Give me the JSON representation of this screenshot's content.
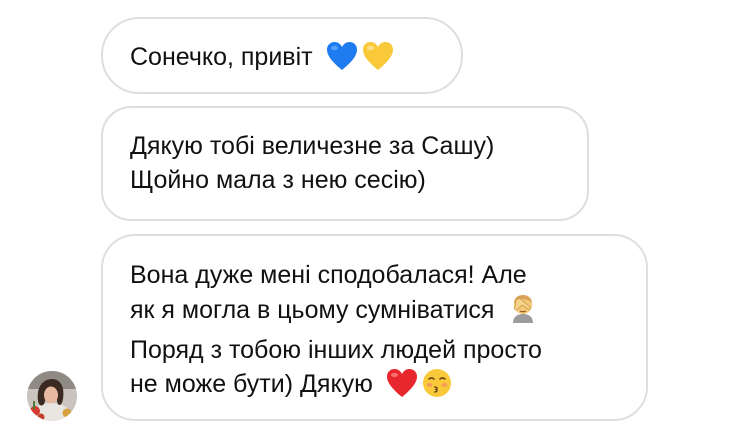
{
  "messages": [
    {
      "lines": [
        "Сонечко, привіт"
      ],
      "emojis": [
        "blue-heart-icon",
        "yellow-heart-icon"
      ]
    },
    {
      "lines": [
        "Дякую тобі величезне за Сашу)",
        "Щойно мала з нею сесію)"
      ]
    },
    {
      "lines": [
        "Вона дуже мені сподобалася! Але",
        "як я могла в цьому сумніватися",
        "Поряд з тобою інших людей просто",
        "не може бути) Дякую"
      ],
      "emojis": [
        "facepalm-icon",
        "red-heart-icon",
        "kissing-face-icon"
      ]
    }
  ],
  "colors": {
    "bubble_border": "#dedede",
    "text": "#111111",
    "blue_heart": "#1f7cf0",
    "yellow_heart": "#f9c93a",
    "red_heart": "#e8262e"
  }
}
